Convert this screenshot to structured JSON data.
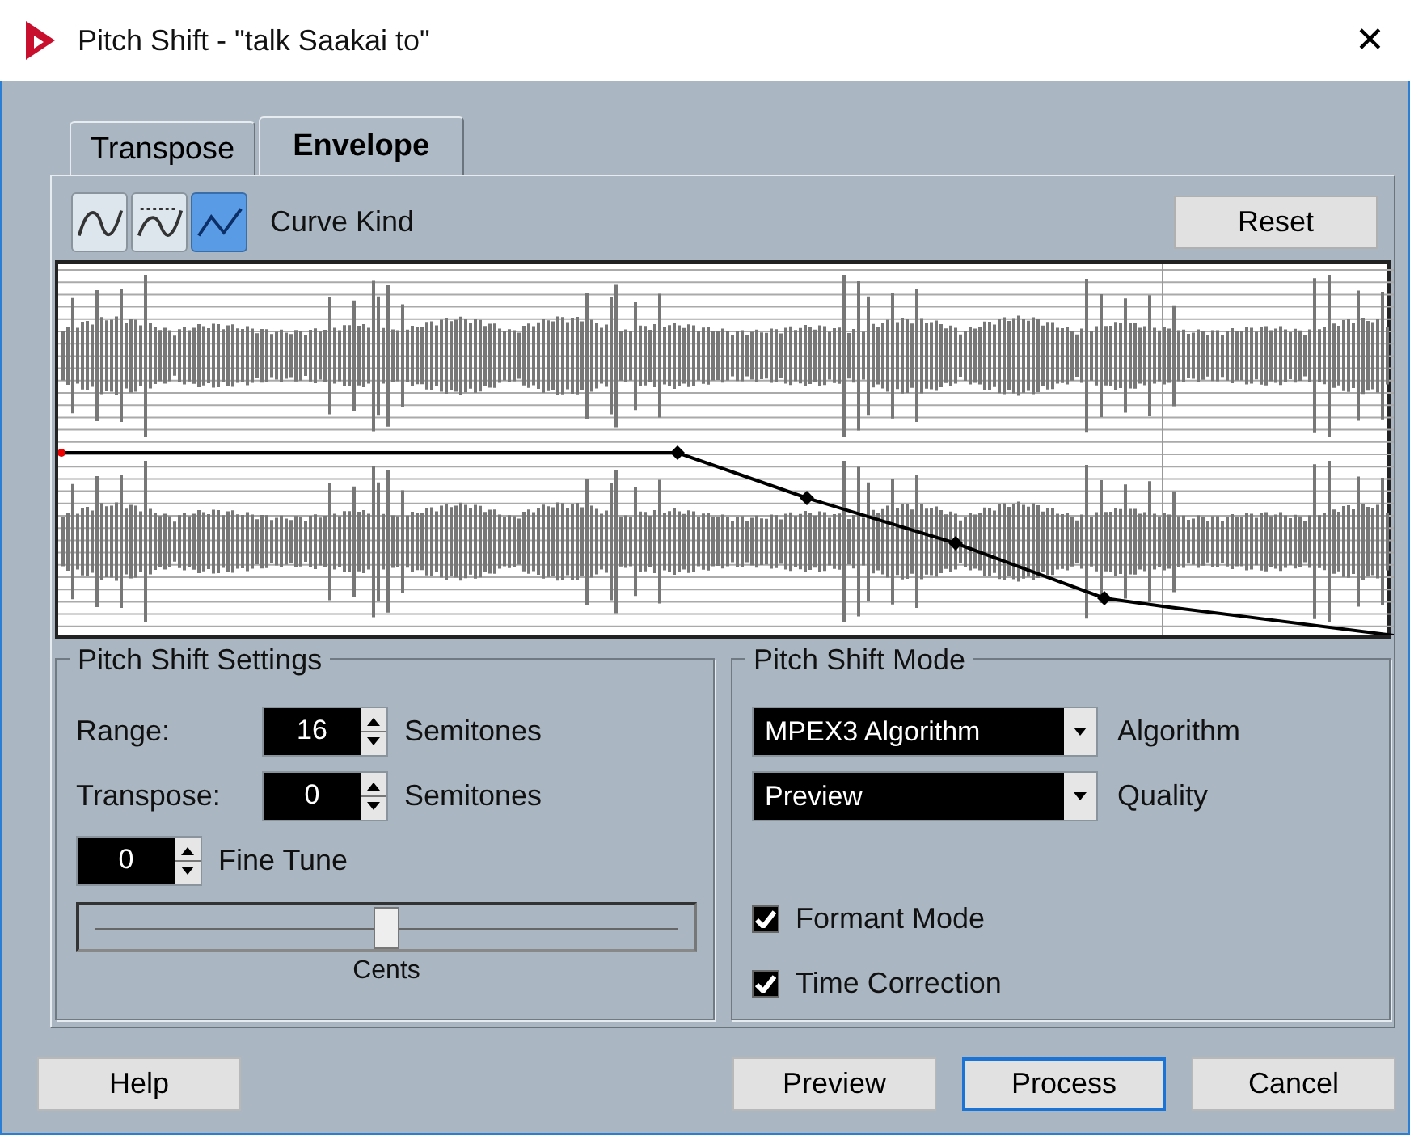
{
  "window": {
    "title": "Pitch Shift - \"talk Saakai to\"",
    "close": "✕"
  },
  "tabs": [
    {
      "label": "Transpose",
      "selected": false
    },
    {
      "label": "Envelope",
      "selected": true
    }
  ],
  "curve_kind": {
    "label": "Curve Kind",
    "buttons": [
      {
        "kind": "spline",
        "selected": false
      },
      {
        "kind": "damped",
        "selected": false
      },
      {
        "kind": "linear",
        "selected": true
      }
    ]
  },
  "reset_button": "Reset",
  "pitch_shift_settings": {
    "title": "Pitch Shift Settings",
    "rows": [
      {
        "label": "Range:",
        "value": "16",
        "unit": "Semitones"
      },
      {
        "label": "Transpose:",
        "value": "0",
        "unit": "Semitones"
      }
    ],
    "fine_tune": {
      "value": "0",
      "label": "Fine Tune"
    },
    "slider": {
      "level": 0.5,
      "label": "Cents"
    }
  },
  "pitch_shift_mode": {
    "title": "Pitch Shift Mode",
    "dropdowns": [
      {
        "value": "MPEX3 Algorithm",
        "label": "Algorithm"
      },
      {
        "value": "Preview",
        "label": "Quality"
      }
    ],
    "checkboxes": [
      {
        "label": "Formant Mode",
        "checked": true
      },
      {
        "label": "Time Correction",
        "checked": true
      }
    ]
  },
  "footer": {
    "left": [
      {
        "label": "Help",
        "default": false
      }
    ],
    "right": [
      {
        "label": "Preview",
        "default": false
      },
      {
        "label": "Process",
        "default": true
      },
      {
        "label": "Cancel",
        "default": false
      }
    ]
  }
}
